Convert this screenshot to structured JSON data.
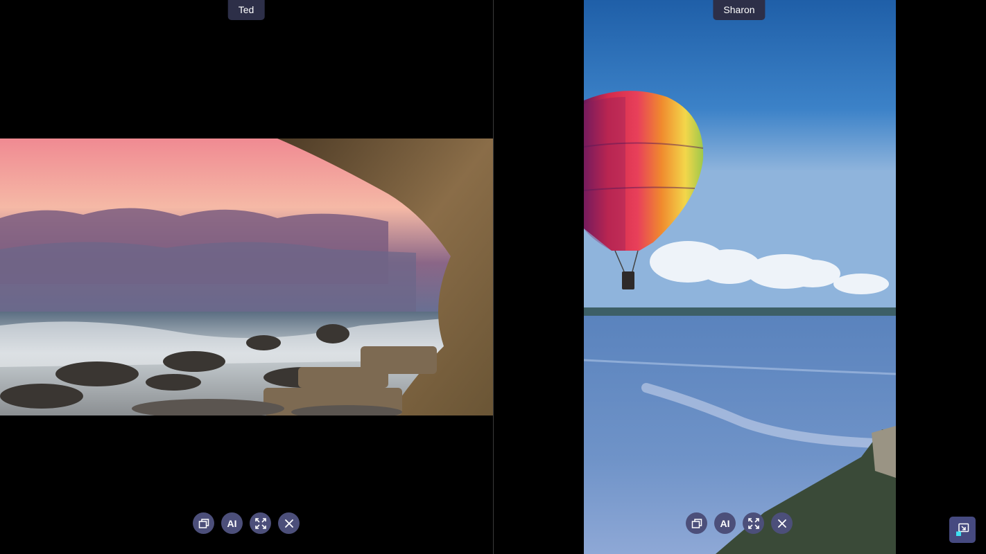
{
  "participants": [
    {
      "name": "Ted"
    },
    {
      "name": "Sharon"
    }
  ],
  "controls": {
    "ai_label": "AI"
  },
  "icons": {
    "window": "window-icon",
    "ai": "ai-icon",
    "expand": "expand-icon",
    "close": "close-icon",
    "picture_in_picture": "picture-in-picture-icon"
  },
  "colors": {
    "background": "#000000",
    "tag_bg": "#2d2f48",
    "button_bg": "#4c4f7a",
    "corner_button_bg": "#464a80",
    "accent": "#3de1f2"
  }
}
